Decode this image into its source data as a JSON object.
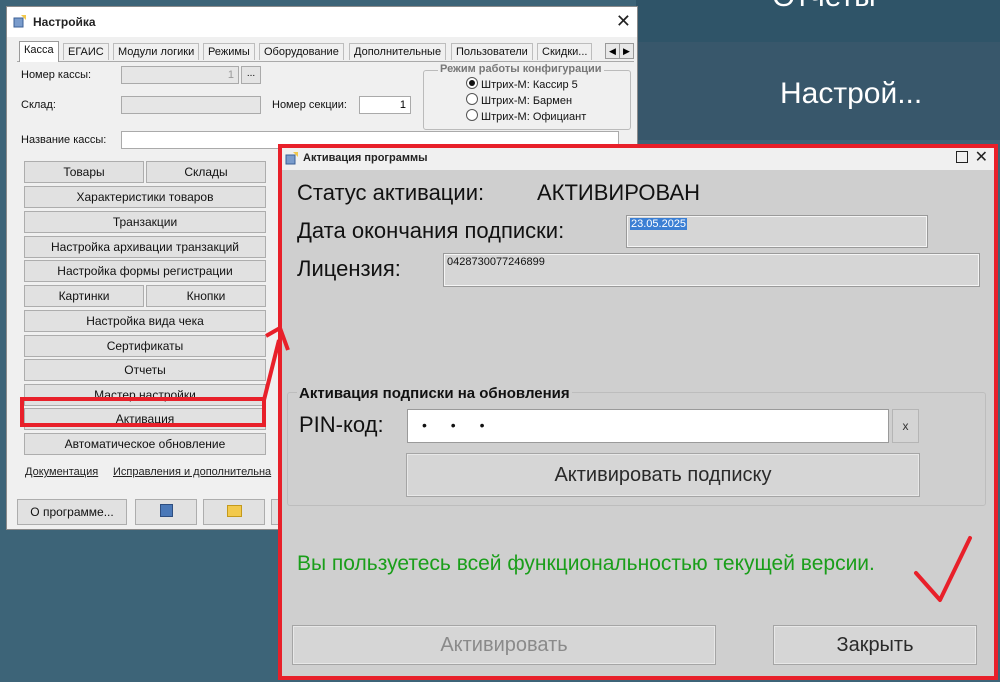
{
  "background": {
    "menu_partial_1": "Отчеты",
    "menu_partial_2": "Настрой..."
  },
  "settings_window": {
    "title": "Настройка",
    "tabs": [
      "Касса",
      "ЕГАИС",
      "Модули логики",
      "Режимы",
      "Оборудование",
      "Дополнительные",
      "Пользователи",
      "Скидки..."
    ],
    "fields": {
      "register_number_label": "Номер кассы:",
      "register_number_value": "1",
      "register_number_button": "...",
      "warehouse_label": "Склад:",
      "warehouse_value": "",
      "section_number_label": "Номер секции:",
      "section_number_value": "1",
      "register_name_label": "Название кассы:",
      "register_name_value": ""
    },
    "mode_group": {
      "title": "Режим работы конфигурации",
      "options": [
        "Штрих-М: Кассир 5",
        "Штрих-М: Бармен",
        "Штрих-М: Официант"
      ],
      "selected_index": 0
    },
    "buttons": {
      "goods": "Товары",
      "warehouses": "Склады",
      "goods_characteristics": "Характеристики товаров",
      "transactions": "Транзакции",
      "transaction_archive": "Настройка архивации транзакций",
      "registration_form": "Настройка формы регистрации",
      "pictures": "Картинки",
      "buttons": "Кнопки",
      "receipt_view": "Настройка вида чека",
      "certificates": "Сертификаты",
      "reports": "Отчеты",
      "setup_wizard": "Мастер настройки",
      "activation": "Активация",
      "auto_update": "Автоматическое обновление"
    },
    "links": {
      "documentation": "Документация",
      "fixes": "Исправления и дополнительна"
    },
    "bottom": {
      "about": "О программе..."
    }
  },
  "activation_dialog": {
    "title": "Активация программы",
    "status_label": "Статус активации:",
    "status_value": "АКТИВИРОВАН",
    "expiry_label": "Дата окончания подписки:",
    "expiry_value": "23.05.2025",
    "license_label": "Лицензия:",
    "license_value": "0428730077246899",
    "subscription_group_title": "Активация подписки на обновления",
    "pin_label": "PIN-код:",
    "pin_value": "• • •",
    "pin_clear": "x",
    "activate_subscription_button": "Активировать подписку",
    "message": "Вы пользуетесь всей функциональностью текущей версии.",
    "activate_button": "Активировать",
    "close_button": "Закрыть"
  },
  "colors": {
    "annotation_red": "#e8202a",
    "message_green": "#1a9e1a",
    "selection_blue": "#3b7fd4"
  }
}
